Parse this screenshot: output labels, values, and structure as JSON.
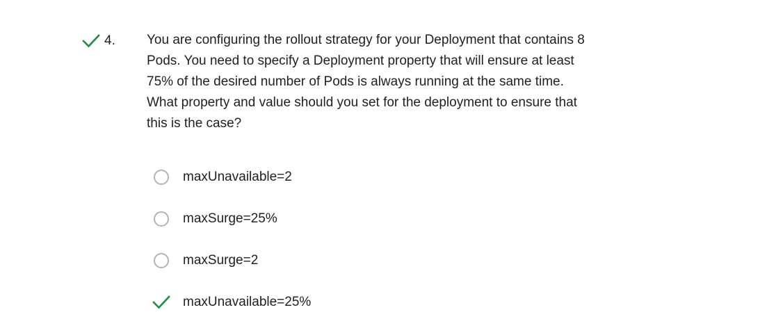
{
  "question": {
    "number": "4.",
    "status_icon": "check-icon",
    "text": "You are configuring the rollout strategy for your Deployment that contains 8 Pods. You need to specify a Deployment property that will ensure at least 75% of the desired number of Pods is always running at the same time. What property and value should you set for the deployment to ensure that this is the case?",
    "options": [
      {
        "label": "maxUnavailable=2",
        "state": "unselected",
        "icon": "radio-button"
      },
      {
        "label": "maxSurge=25%",
        "state": "unselected",
        "icon": "radio-button"
      },
      {
        "label": "maxSurge=2",
        "state": "unselected",
        "icon": "radio-button"
      },
      {
        "label": "maxUnavailable=25%",
        "state": "correct",
        "icon": "check-icon"
      }
    ]
  },
  "colors": {
    "correct_green": "#1e8e3e",
    "text": "#202124",
    "radio_border": "#b0b3b8"
  }
}
